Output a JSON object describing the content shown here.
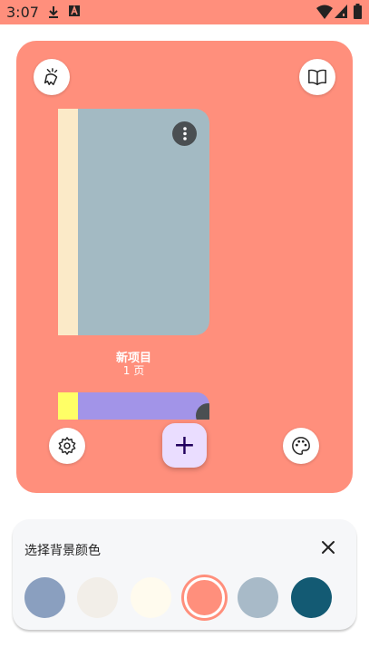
{
  "status_bar": {
    "time": "3:07",
    "background": "#FF8F7C"
  },
  "project": {
    "title": "新项目",
    "pages": "1 页",
    "cover_color": "#A3BAC3",
    "spine_color": "#FBEAC8"
  },
  "project2": {
    "cover_color": "#A294E8",
    "spine_color": "#FFFF66"
  },
  "card": {
    "background": "#FF8F7C"
  },
  "fab": {
    "label": "+"
  },
  "color_picker": {
    "title": "选择背景颜色",
    "selected_index": 3,
    "swatches": [
      "#8A9FBF",
      "#F2EEE8",
      "#FFFBEE",
      "#FF8F7C",
      "#A8BAC8",
      "#135A73"
    ]
  }
}
